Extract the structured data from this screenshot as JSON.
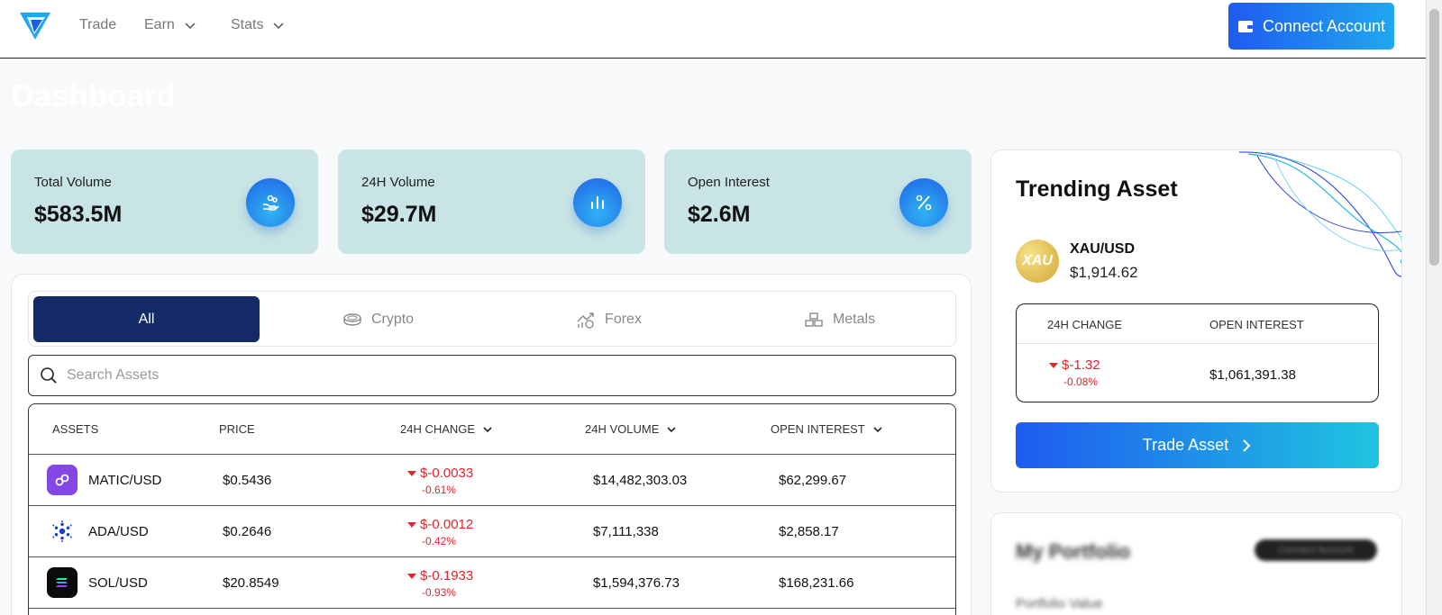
{
  "nav": {
    "items": [
      {
        "label": "Trade",
        "has_dropdown": false
      },
      {
        "label": "Earn",
        "has_dropdown": true
      },
      {
        "label": "Stats",
        "has_dropdown": true
      }
    ],
    "connect_label": "Connect Account"
  },
  "page_title": "Dashboard",
  "stats": [
    {
      "label": "Total Volume",
      "value": "$583.5M",
      "icon": "hand-coins-icon"
    },
    {
      "label": "24H Volume",
      "value": "$29.7M",
      "icon": "bar-chart-icon"
    },
    {
      "label": "Open Interest",
      "value": "$2.6M",
      "icon": "percent-icon"
    }
  ],
  "tabs": [
    {
      "label": "All",
      "active": true
    },
    {
      "label": "Crypto",
      "icon": "coins-icon",
      "active": false
    },
    {
      "label": "Forex",
      "icon": "forex-chart-icon",
      "active": false
    },
    {
      "label": "Metals",
      "icon": "metal-bars-icon",
      "active": false
    }
  ],
  "search": {
    "placeholder": "Search Assets",
    "value": ""
  },
  "table": {
    "headers": [
      "ASSETS",
      "PRICE",
      "24H CHANGE",
      "24H VOLUME",
      "OPEN INTEREST"
    ],
    "rows": [
      {
        "asset": "MATIC/USD",
        "price": "$0.5436",
        "change": "$-0.0033",
        "change_pct": "-0.61%",
        "volume": "$14,482,303.03",
        "oi": "$62,299.67",
        "icon": "polygon-icon"
      },
      {
        "asset": "ADA/USD",
        "price": "$0.2646",
        "change": "$-0.0012",
        "change_pct": "-0.42%",
        "volume": "$7,111,338",
        "oi": "$2,858.17",
        "icon": "cardano-icon"
      },
      {
        "asset": "SOL/USD",
        "price": "$20.8549",
        "change": "$-0.1933",
        "change_pct": "-0.93%",
        "volume": "$1,594,376.73",
        "oi": "$168,231.66",
        "icon": "solana-icon"
      }
    ]
  },
  "trending": {
    "title": "Trending Asset",
    "icon_text": "XAU",
    "asset": "XAU/USD",
    "price": "$1,914.62",
    "change_header": "24H CHANGE",
    "oi_header": "OPEN INTEREST",
    "change": "$-1.32",
    "change_pct": "-0.08%",
    "oi": "$1,061,391.38",
    "trade_label": "Trade Asset"
  },
  "portfolio": {
    "title": "My Portfolio",
    "pill": "Connect Account",
    "value_label": "Portfolio Value"
  },
  "colors": {
    "accent": "#1f5bf0",
    "navy": "#142a66",
    "negative": "#e0252b",
    "stat_card_bg": "#c9e4e4"
  }
}
